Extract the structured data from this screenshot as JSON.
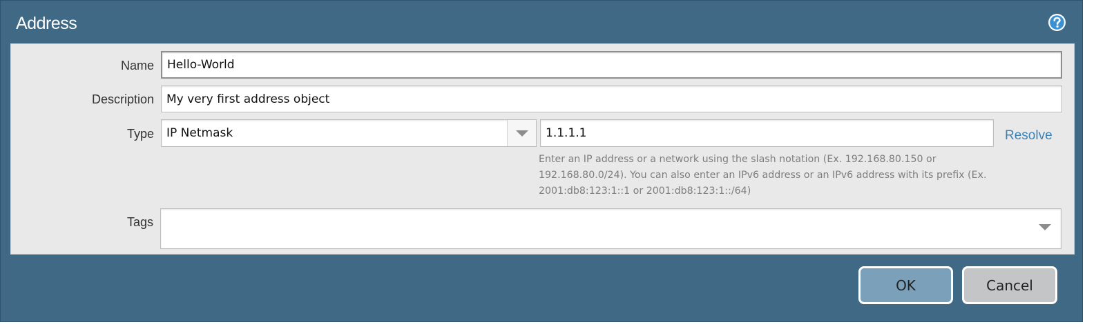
{
  "window": {
    "title": "Address",
    "help_icon": "question-circle-icon"
  },
  "form": {
    "name": {
      "label": "Name",
      "value": "Hello-World"
    },
    "description": {
      "label": "Description",
      "value": "My very first address object"
    },
    "type": {
      "label": "Type",
      "selected": "IP Netmask",
      "address_value": "1.1.1.1",
      "resolve_label": "Resolve",
      "help_line1": "Enter an IP address or a network using the slash notation (Ex. 192.168.80.150 or",
      "help_line2": "192.168.80.0/24). You can also enter an IPv6 address or an IPv6 address with its prefix (Ex.",
      "help_line3": "2001:db8:123:1::1 or 2001:db8:123:1::/64)"
    },
    "tags": {
      "label": "Tags",
      "value": ""
    }
  },
  "buttons": {
    "ok": "OK",
    "cancel": "Cancel"
  },
  "colors": {
    "dialog_bg": "#3f6985",
    "panel_bg": "#e9e9e9",
    "ok_button": "#7aa1b9",
    "cancel_button": "#c4c5c7",
    "link": "#3a82b6"
  }
}
